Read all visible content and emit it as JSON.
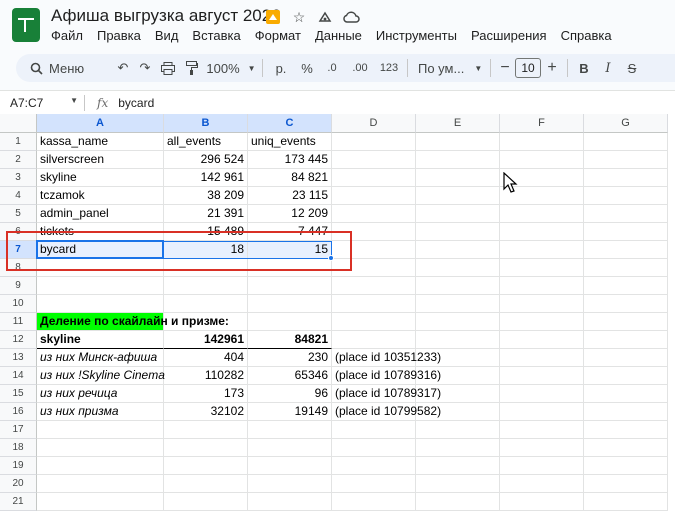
{
  "window": {
    "doc_title": "Афиша выгрузка август 2026",
    "colors": {
      "brand": "#188038",
      "selection": "#1a73e8",
      "highlight_green": "#00ff00",
      "annotation_red": "#d93025"
    }
  },
  "menu": [
    "Файл",
    "Правка",
    "Вид",
    "Вставка",
    "Формат",
    "Данные",
    "Инструменты",
    "Расширения",
    "Справка"
  ],
  "toolbar": {
    "search_label": "Меню",
    "zoom": "100%",
    "currency": "р.",
    "percent": "%",
    "decimal_decrease": ".0",
    "decimal_increase": ".00",
    "number_format": "123",
    "font_name": "По ум...",
    "font_size": "10",
    "minus": "−",
    "plus": "+",
    "bold": "B",
    "italic": "I",
    "strikethrough": "S"
  },
  "formula_bar": {
    "name_box": "A7:C7",
    "fx": "fx",
    "value": "bycard"
  },
  "columns": [
    "A",
    "B",
    "C",
    "D",
    "E",
    "F",
    "G"
  ],
  "rows": [
    "1",
    "2",
    "3",
    "4",
    "5",
    "6",
    "7",
    "8",
    "9",
    "10",
    "11",
    "12",
    "13",
    "14",
    "15",
    "16",
    "17",
    "18",
    "19",
    "20",
    "21"
  ],
  "cells": {
    "r1": [
      "kassa_name",
      "all_events",
      "uniq_events"
    ],
    "r2": [
      "silverscreen",
      "296 524",
      "173 445"
    ],
    "r3": [
      "skyline",
      "142 961",
      "84 821"
    ],
    "r4": [
      "tczamok",
      "38 209",
      "23 115"
    ],
    "r5": [
      "admin_panel",
      "21 391",
      "12 209"
    ],
    "r6": [
      "tickets",
      "15 489",
      "7 447"
    ],
    "r7": [
      "bycard",
      "18",
      "15"
    ],
    "r11": [
      "Деление по скайлайн и призме:"
    ],
    "r12": [
      "skyline",
      "142961",
      "84821"
    ],
    "r13": [
      "из них Минск-афиша",
      "404",
      "230",
      "(place id 10351233)"
    ],
    "r14": [
      "из них !Skyline Cinema",
      "110282",
      "65346",
      "(place id 10789316)"
    ],
    "r15": [
      "из них речица",
      "173",
      "96",
      "(place id 10789317)"
    ],
    "r16": [
      "из них призма",
      "32102",
      "19149",
      "(place id 10799582)"
    ]
  }
}
